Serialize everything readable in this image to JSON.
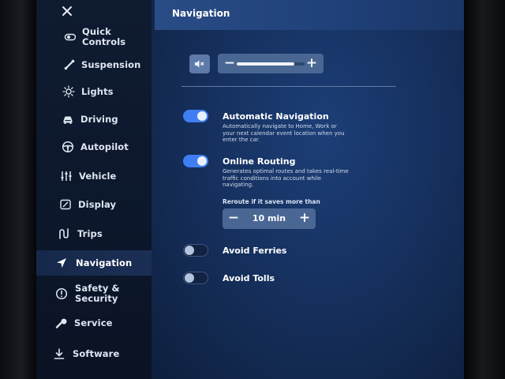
{
  "sidebar": {
    "close_icon": "close-icon",
    "items": [
      {
        "label": "Quick Controls",
        "icon": "quick-controls-icon"
      },
      {
        "label": "Suspension",
        "icon": "suspension-icon"
      },
      {
        "label": "Lights",
        "icon": "lights-icon"
      },
      {
        "label": "Driving",
        "icon": "car-icon"
      },
      {
        "label": "Autopilot",
        "icon": "steering-wheel-icon"
      },
      {
        "label": "Vehicle",
        "icon": "sliders-icon"
      },
      {
        "label": "Display",
        "icon": "display-icon"
      },
      {
        "label": "Trips",
        "icon": "trips-icon"
      },
      {
        "label": "Navigation",
        "icon": "navigation-arrow-icon",
        "active": true
      },
      {
        "label": "Safety &",
        "label2": "Security",
        "icon": "alert-icon"
      },
      {
        "label": "Service",
        "icon": "wrench-icon"
      },
      {
        "label": "Software",
        "icon": "download-icon"
      }
    ]
  },
  "header": {
    "title": "Navigation"
  },
  "volume": {
    "mute_icon": "speaker-mute-icon",
    "minus": "−",
    "plus": "+",
    "level": 0.85
  },
  "options": {
    "auto_nav": {
      "title": "Automatic Navigation",
      "desc": "Automatically navigate to Home, Work or your next calendar event location when you enter the car.",
      "enabled": true
    },
    "online_routing": {
      "title": "Online Routing",
      "desc": "Generates optimal routes and takes real-time traffic conditions into account while navigating.",
      "enabled": true
    },
    "reroute": {
      "label": "Reroute if it saves more than",
      "value": "10 min",
      "minus": "−",
      "plus": "+"
    },
    "avoid_ferries": {
      "title": "Avoid Ferries",
      "enabled": false
    },
    "avoid_tolls": {
      "title": "Avoid Tolls",
      "enabled": false
    }
  },
  "colors": {
    "accent": "#3f7ef2",
    "header": "#2a4c86",
    "sidebar": "#0f1b31"
  }
}
